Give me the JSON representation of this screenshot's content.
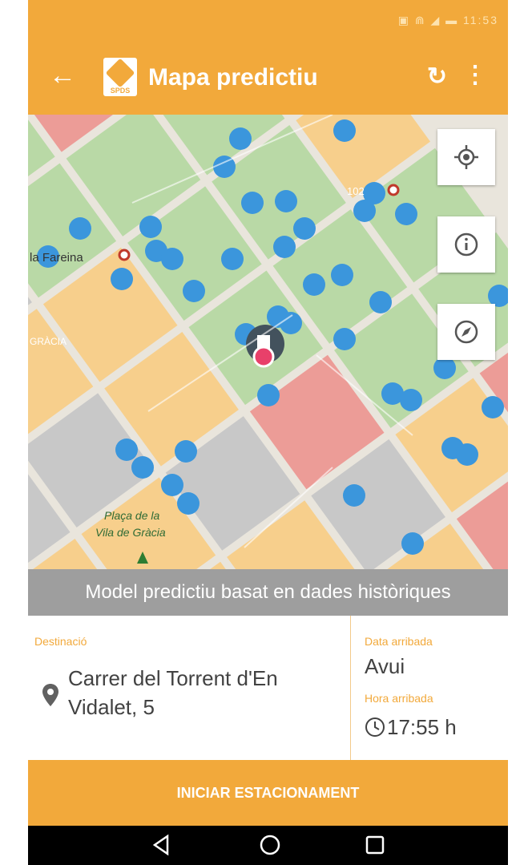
{
  "status_bar": {
    "icons": "▣ ⋒ ◢ ▬",
    "time": "11:53"
  },
  "toolbar": {
    "back_icon": "arrow-left-icon",
    "logo_text": "SPDS",
    "title": "Mapa predictiu",
    "refresh_icon": "refresh-icon",
    "more_icon": "more-vert-icon"
  },
  "map": {
    "labels": {
      "place_left": "la Fareina",
      "district": "GRÀCIA",
      "square_line1": "Plaça de la",
      "square_line2": "Vila de Gràcia",
      "number_label": "102"
    },
    "buttons": {
      "locate": "my-location-icon",
      "info": "info-icon",
      "compass": "compass-icon"
    },
    "colors": {
      "green": "#b9d9a6",
      "orange": "#f7cf8c",
      "red": "#ec9c97",
      "grey": "#c8c8c8",
      "spot": "#3b96dc",
      "marker": "#e8406a"
    }
  },
  "banner": {
    "text": "Model predictiu basat en dades històriques"
  },
  "destination": {
    "label": "Destinació",
    "address": "Carrer del Torrent d'En Vidalet, 5"
  },
  "arrival": {
    "date_label": "Data arribada",
    "date_value": "Avui",
    "time_label": "Hora arribada",
    "time_value": "17:55 h"
  },
  "cta": {
    "label": "INICIAR ESTACIONAMENT"
  },
  "nav": {
    "back": "nav-back-icon",
    "home": "nav-home-icon",
    "recents": "nav-recents-icon"
  },
  "colors": {
    "accent": "#f2a93b",
    "banner": "#9e9e9e",
    "text": "#424242"
  }
}
